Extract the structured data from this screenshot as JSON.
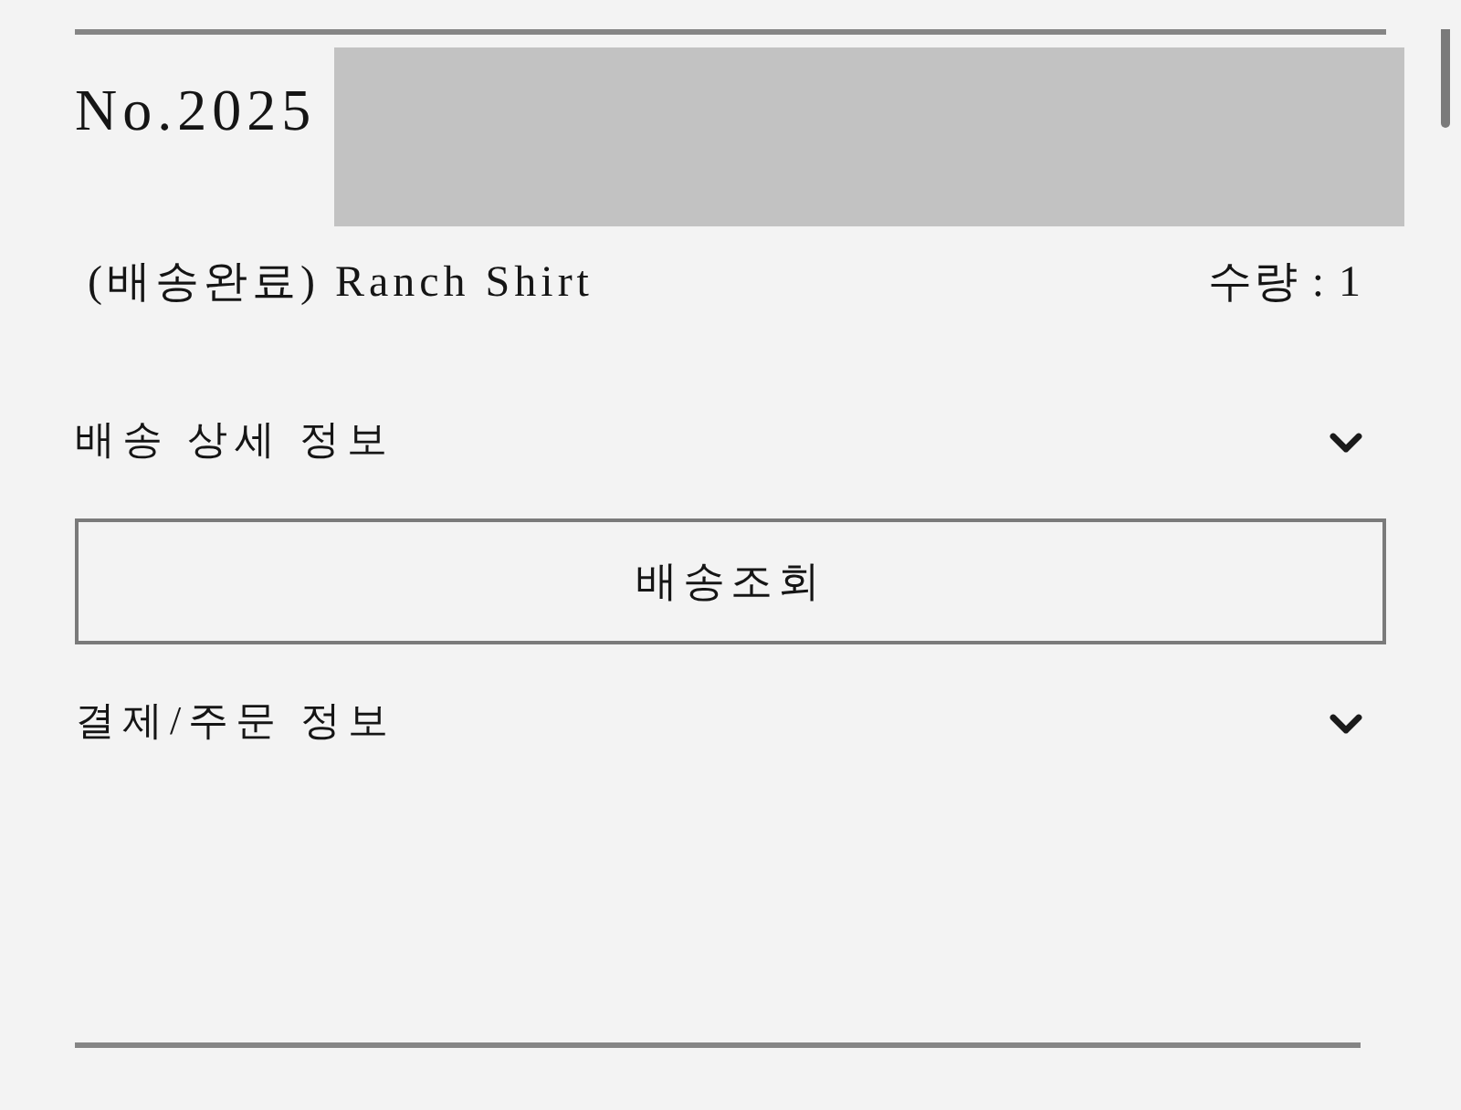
{
  "order": {
    "number": "No.2025",
    "product": "(배송완료) Ranch Shirt",
    "quantity": "수량 : 1"
  },
  "sections": [
    {
      "title": "배송 상세 정보",
      "expanded": false,
      "button": "배송조회"
    },
    {
      "title": "결제/주문 정보",
      "expanded": false
    }
  ]
}
